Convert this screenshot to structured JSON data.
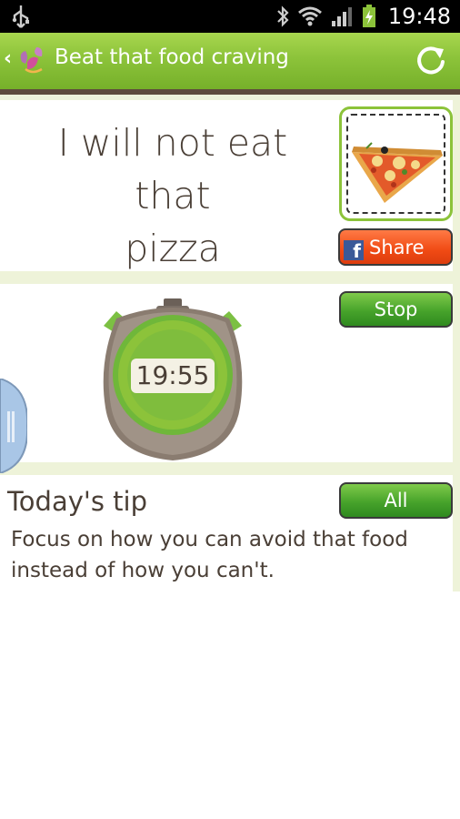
{
  "status_bar": {
    "time": "19:48",
    "icons": [
      "usb-icon",
      "bluetooth-icon",
      "wifi-icon",
      "signal-icon",
      "battery-charging-icon"
    ]
  },
  "action_bar": {
    "title": "Beat that food craving",
    "back_icon": "chevron-left-icon",
    "refresh_icon": "refresh-icon"
  },
  "goal": {
    "line1": "I will not eat",
    "line2": "that",
    "line3": "pizza",
    "image": "pizza-slice",
    "share_label": "Share",
    "share_icon": "facebook-icon"
  },
  "timer": {
    "display": "19:55",
    "stop_label": "Stop"
  },
  "tip": {
    "title": "Today's tip",
    "all_label": "All",
    "text": "Focus on how you can avoid that food instead of how you can't."
  },
  "colors": {
    "accent_green": "#8cc33a",
    "share_orange": "#f04a14",
    "text_brown": "#4a3f36",
    "separator": "#eef3d9"
  }
}
